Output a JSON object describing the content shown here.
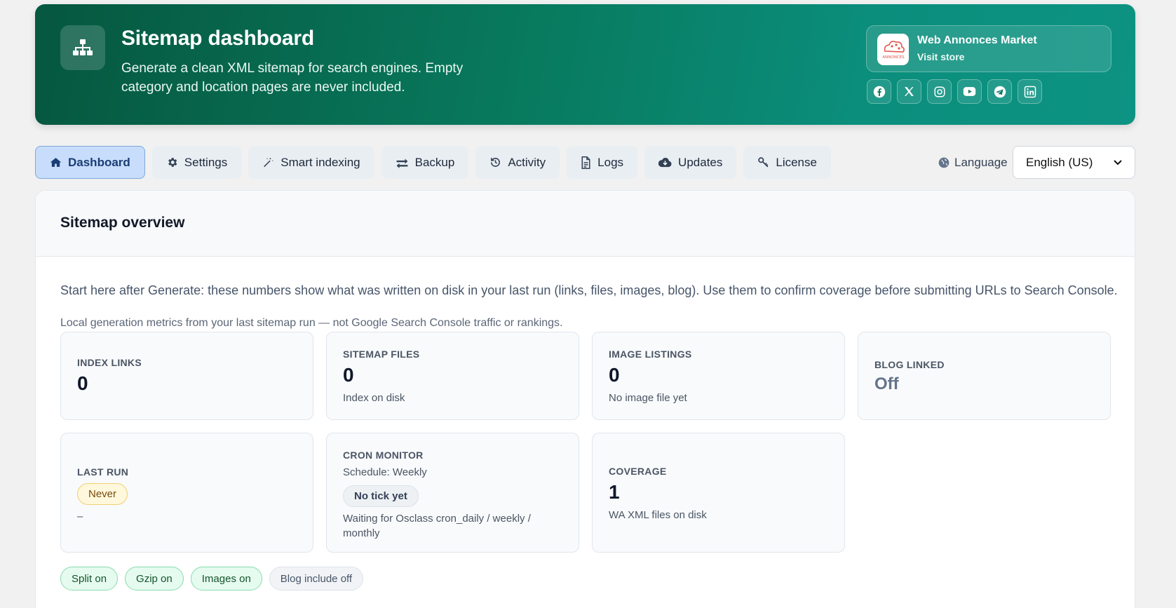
{
  "header": {
    "title": "Sitemap dashboard",
    "subtitle": "Generate a clean XML sitemap for search engines. Empty category and location pages are never included.",
    "icon": "sitemap-icon"
  },
  "store": {
    "name": "Web Annonces Market",
    "link": "Visit store",
    "logo_text": "ANNONCES",
    "socials": [
      "facebook-icon",
      "x-icon",
      "instagram-icon",
      "youtube-icon",
      "telegram-icon",
      "linkedin-icon"
    ]
  },
  "tabs": [
    {
      "label": "Dashboard",
      "icon": "home-icon",
      "active": true
    },
    {
      "label": "Settings",
      "icon": "gear-icon"
    },
    {
      "label": "Smart indexing",
      "icon": "magic-wand-icon"
    },
    {
      "label": "Backup",
      "icon": "swap-arrows-icon"
    },
    {
      "label": "Activity",
      "icon": "history-icon"
    },
    {
      "label": "Logs",
      "icon": "document-icon"
    },
    {
      "label": "Updates",
      "icon": "cloud-download-icon"
    },
    {
      "label": "License",
      "icon": "key-icon"
    }
  ],
  "language": {
    "label": "Language",
    "selected": "English (US)",
    "icon": "globe-icon"
  },
  "overview": {
    "title": "Sitemap overview",
    "intro": "Start here after Generate: these numbers show what was written on disk in your last run (links, files, images, blog). Use them to confirm coverage before submitting URLs to Search Console.",
    "note": "Local generation metrics from your last sitemap run — not Google Search Console traffic or rankings."
  },
  "cards": {
    "index_links": {
      "label": "INDEX LINKS",
      "value": "0"
    },
    "sitemap_files": {
      "label": "SITEMAP FILES",
      "value": "0",
      "sub": "Index on disk"
    },
    "image_listings": {
      "label": "IMAGE LISTINGS",
      "value": "0",
      "sub": "No image file yet"
    },
    "blog_linked": {
      "label": "BLOG LINKED",
      "value": "Off"
    },
    "last_run": {
      "label": "LAST RUN",
      "badge": "Never",
      "sub": "–"
    },
    "cron_monitor": {
      "label": "CRON MONITOR",
      "schedule": "Schedule: Weekly",
      "badge": "No tick yet",
      "sub": "Waiting for Osclass cron_daily / weekly / monthly"
    },
    "coverage": {
      "label": "COVERAGE",
      "value": "1",
      "sub": "WA XML files on disk"
    }
  },
  "chips": [
    {
      "label": "Split on",
      "state": "on"
    },
    {
      "label": "Gzip on",
      "state": "on"
    },
    {
      "label": "Images on",
      "state": "on"
    },
    {
      "label": "Blog include off",
      "state": "off"
    }
  ],
  "colors": {
    "hero_start": "#06573f",
    "hero_end": "#0d9383",
    "active_tab": "#c7ddfb",
    "chip_on": "#e6fbef"
  }
}
